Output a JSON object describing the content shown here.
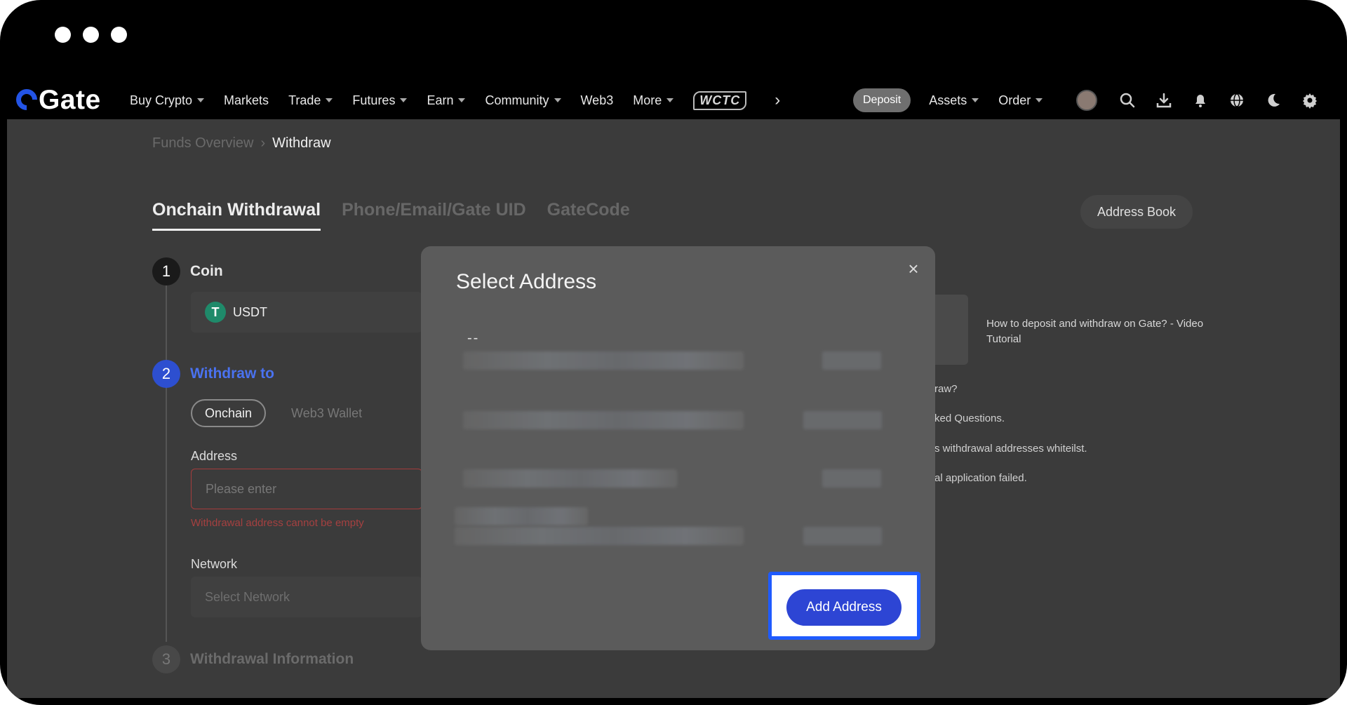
{
  "nav": {
    "logo_text": "Gate",
    "items": [
      {
        "label": "Buy Crypto",
        "caret": true
      },
      {
        "label": "Markets",
        "caret": false
      },
      {
        "label": "Trade",
        "caret": true
      },
      {
        "label": "Futures",
        "caret": true
      },
      {
        "label": "Earn",
        "caret": true
      },
      {
        "label": "Community",
        "caret": true
      },
      {
        "label": "Web3",
        "caret": false
      },
      {
        "label": "More",
        "caret": true
      }
    ],
    "wctc_label": "WCTC",
    "more_arrow": "›",
    "deposit_label": "Deposit",
    "assets_label": "Assets",
    "order_label": "Order"
  },
  "breadcrumb": {
    "parent": "Funds Overview",
    "separator": "›",
    "current": "Withdraw"
  },
  "tabs": [
    {
      "label": "Onchain Withdrawal",
      "active": true
    },
    {
      "label": "Phone/Email/Gate UID",
      "active": false
    },
    {
      "label": "GateCode",
      "active": false
    }
  ],
  "address_book_label": "Address Book",
  "steps": {
    "coin": {
      "num": "1",
      "label": "Coin"
    },
    "withdraw_to": {
      "num": "2",
      "label": "Withdraw to"
    },
    "withdraw_info": {
      "num": "3",
      "label": "Withdrawal Information"
    }
  },
  "coin": {
    "icon_glyph": "T",
    "name": "USDT"
  },
  "withdraw_targets": [
    {
      "label": "Onchain",
      "active": true
    },
    {
      "label": "Web3 Wallet",
      "active": false
    }
  ],
  "address_field": {
    "label": "Address",
    "placeholder": "Please enter",
    "value": "",
    "error": "Withdrawal address cannot be empty"
  },
  "network_field": {
    "label": "Network",
    "placeholder": "Select Network"
  },
  "help": {
    "video_title": "How to deposit and withdraw on Gate? - Video Tutorial",
    "faq_fragments": [
      "raw?",
      "ked Questions.",
      "s withdrawal addresses whiteilst.",
      "al application failed."
    ]
  },
  "modal": {
    "title": "Select Address",
    "close_glyph": "×",
    "first_item_label": "--",
    "add_address_label": "Add Address"
  },
  "colors": {
    "accent_blue": "#2d45d4",
    "highlight_blue": "#1f5bff",
    "error_red": "#a54040",
    "usdt_green": "#1f8a6a"
  }
}
